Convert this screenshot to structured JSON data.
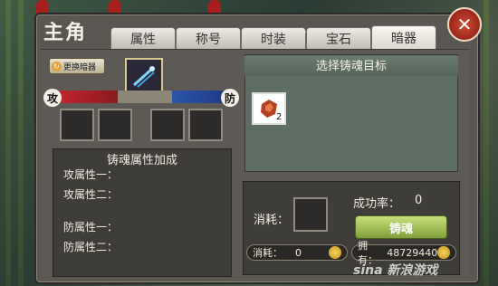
{
  "title": "主角",
  "tabs": [
    {
      "label": "属性"
    },
    {
      "label": "称号"
    },
    {
      "label": "时装"
    },
    {
      "label": "宝石"
    },
    {
      "label": "暗器"
    }
  ],
  "active_tab": "暗器",
  "left": {
    "swap_button_label": "更换暗器",
    "attack_label": "攻",
    "defense_label": "防",
    "attr_title": "铸魂属性加成",
    "attr_lines": [
      "攻属性一：",
      "攻属性二：",
      "防属性一：",
      "防属性二："
    ]
  },
  "right": {
    "target_title": "选择铸魂目标",
    "item_count": "2",
    "cost_label": "消耗：",
    "success_rate_label": "成功率：",
    "success_rate_value": "0",
    "forge_button_label": "铸魂",
    "consume_label": "消耗：",
    "consume_value": "0",
    "own_label": "拥有：",
    "own_value": "48729440"
  },
  "watermark": "sina 新浪游戏"
}
